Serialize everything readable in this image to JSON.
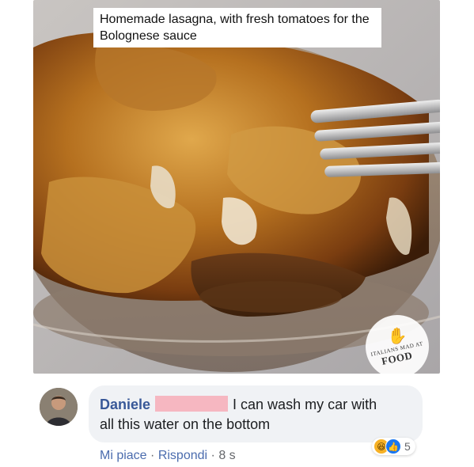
{
  "post": {
    "caption": "Homemade lasagna, with fresh tomatoes for the Bolognese sauce"
  },
  "watermark": {
    "top_text": "ITALIANS MAD AT",
    "bottom_text": "FOOD"
  },
  "comment": {
    "author": "Daniele",
    "text_line1": "I can wash my car with",
    "text_line2": "all this water on the bottom",
    "reaction_count": "5",
    "reactions": [
      "haha-icon",
      "like-icon"
    ],
    "actions": {
      "like": "Mi piace",
      "separator": "·",
      "reply": "Rispondi",
      "time": "8 s"
    }
  },
  "colors": {
    "author_link": "#385898",
    "bubble_bg": "#f0f2f5",
    "redaction": "#f6b7c1",
    "like_blue": "#1877f2",
    "haha_yellow": "#f7b125"
  }
}
